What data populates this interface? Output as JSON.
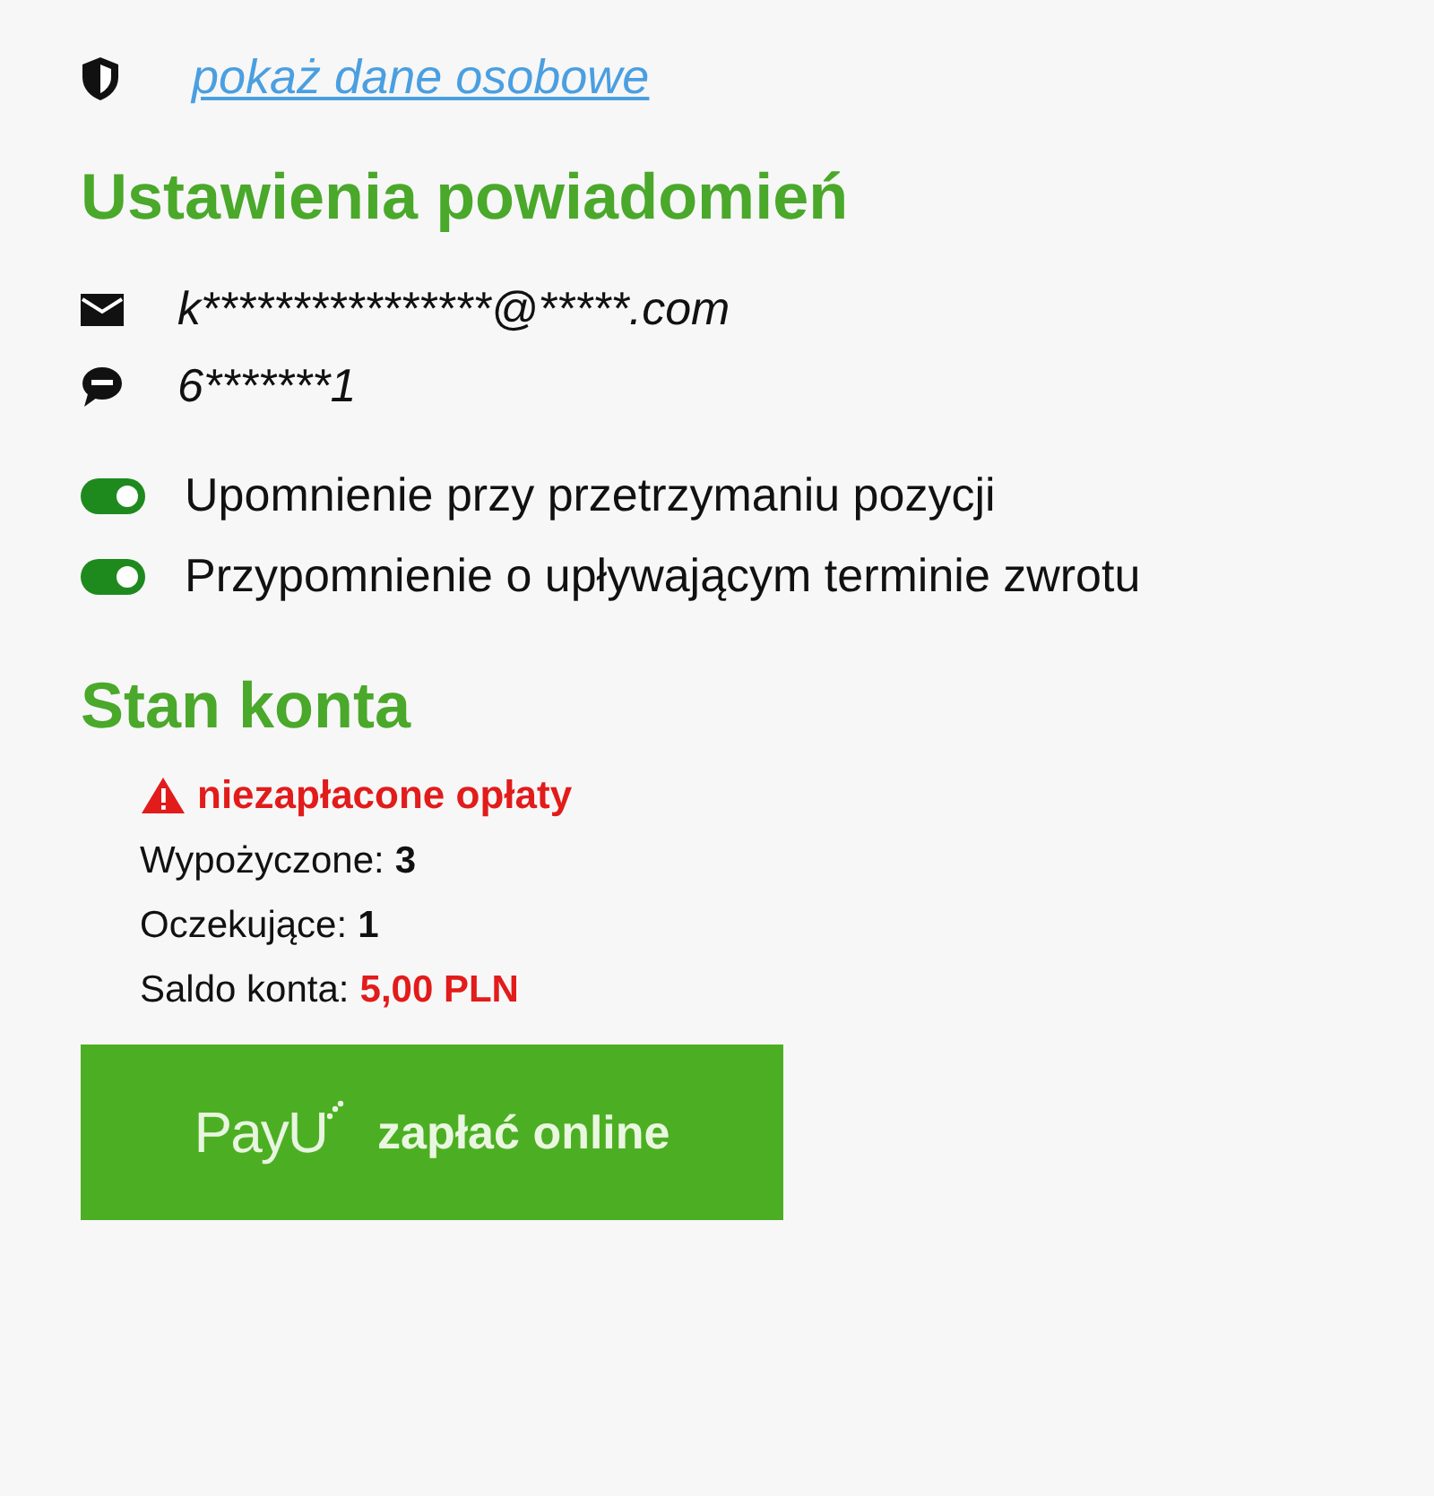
{
  "personal_link": {
    "text": "pokaż dane osobowe"
  },
  "notifications": {
    "title": "Ustawienia powiadomień",
    "contacts": [
      {
        "kind": "email",
        "value": "k****************@*****.com"
      },
      {
        "kind": "sms",
        "value": "6*******1"
      }
    ],
    "toggles": [
      {
        "label": "Upomnienie przy przetrzymaniu pozycji",
        "on": true
      },
      {
        "label": "Przypomnienie o upływającym terminie zwrotu",
        "on": true
      }
    ]
  },
  "account": {
    "title": "Stan konta",
    "warning": "niezapłacone opłaty",
    "rows": [
      {
        "label": "Wypożyczone:",
        "value": "3",
        "alert": false
      },
      {
        "label": "Oczekujące:",
        "value": "1",
        "alert": false
      },
      {
        "label": "Saldo konta:",
        "value": "5,00 PLN",
        "alert": true
      }
    ],
    "pay_button": {
      "logo": "PayU",
      "label": "zapłać online"
    }
  }
}
